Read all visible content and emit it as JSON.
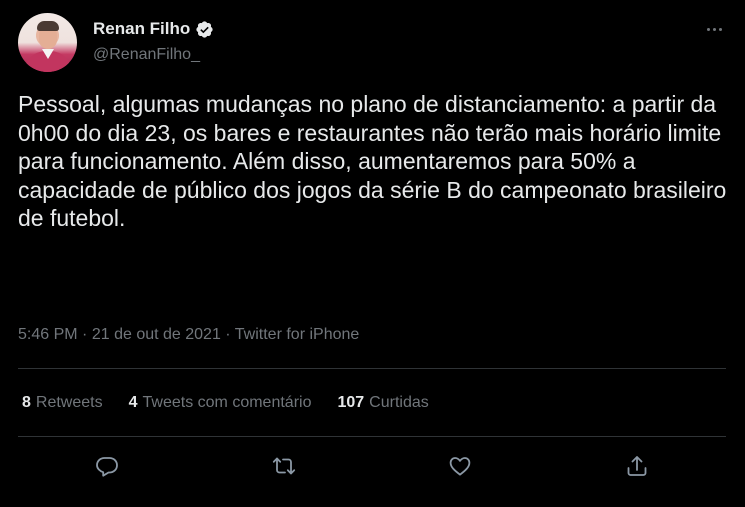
{
  "user": {
    "display_name": "Renan Filho",
    "handle": "@RenanFilho_",
    "verified": true
  },
  "tweet": {
    "text": "Pessoal, algumas mudanças no plano de distanciamento: a partir da 0h00 do dia 23, os bares e restaurantes não terão mais horário limite para funcionamento. Além disso, aumentaremos para 50% a capacidade de público dos jogos da série B do campeonato brasileiro de futebol.",
    "time": "5:46 PM",
    "date": "21 de out de 2021",
    "source": "Twitter for iPhone",
    "separator": "·"
  },
  "stats": {
    "retweets_count": "8",
    "retweets_label": "Retweets",
    "quotes_count": "4",
    "quotes_label": "Tweets com comentário",
    "likes_count": "107",
    "likes_label": "Curtidas"
  },
  "icons": {
    "verified": "verified-badge-icon",
    "more": "more-options-icon",
    "reply": "reply-icon",
    "retweet": "retweet-icon",
    "like": "heart-icon",
    "share": "share-icon"
  },
  "colors": {
    "background": "#000000",
    "text_primary": "#e7e9ea",
    "text_secondary": "#71767b",
    "divider": "#2f3336",
    "verified_fill": "#e7e9ea"
  }
}
